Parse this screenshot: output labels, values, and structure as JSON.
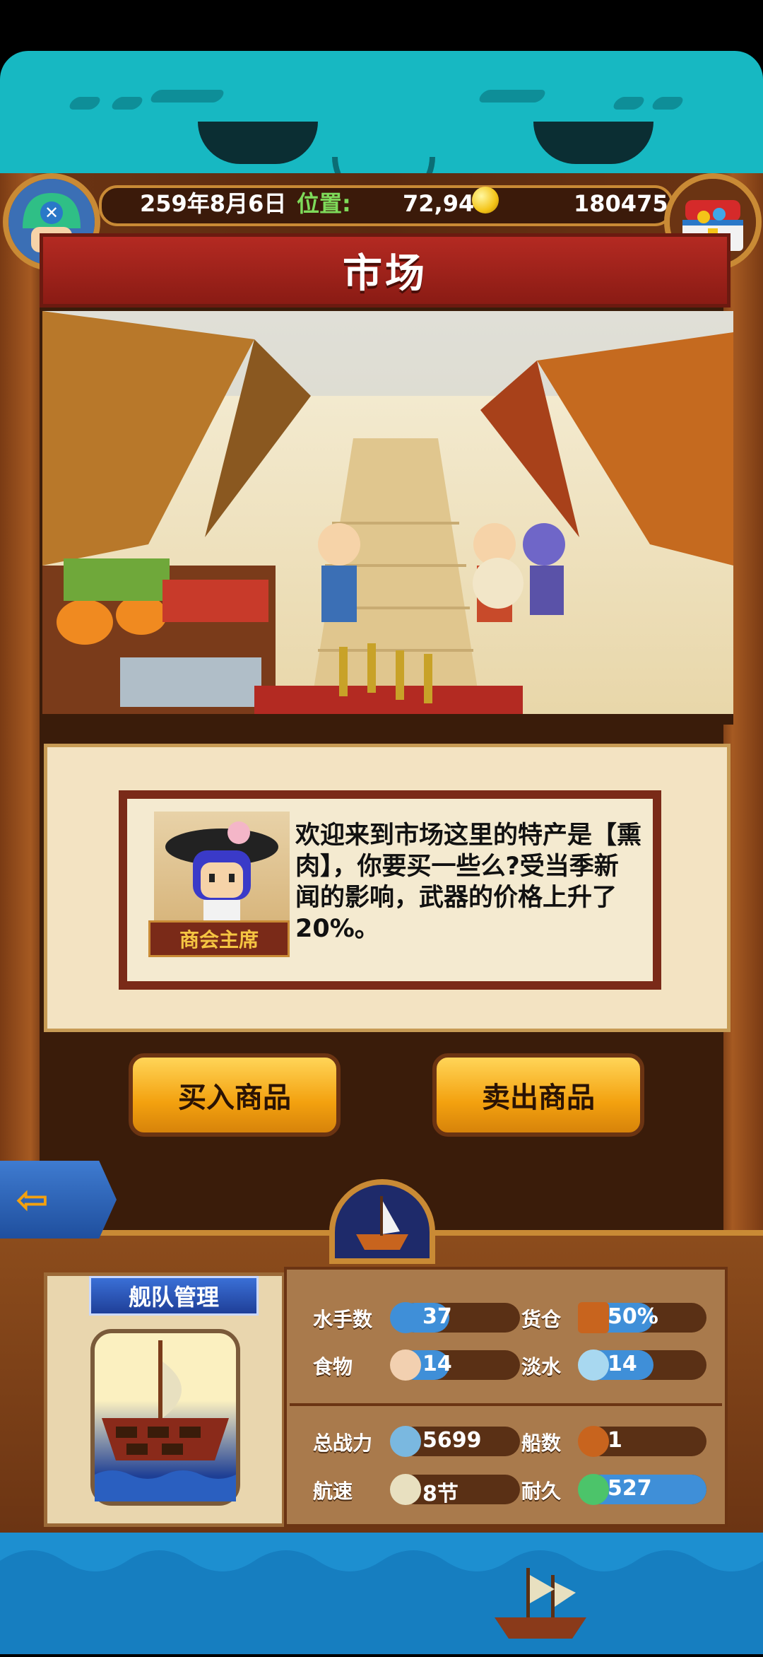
{
  "header": {
    "date": "259年8月6日",
    "location_label": "位置:",
    "coordinates": "72,94",
    "gold": "180475"
  },
  "title": "市场",
  "dialog": {
    "speaker_role": "商会主席",
    "message": "欢迎来到市场这里的特产是【熏肉】，你要买一些么?受当季新闻的影响，武器的价格上升了20%。"
  },
  "buttons": {
    "buy": "买入商品",
    "sell": "卖出商品"
  },
  "fleet": {
    "label": "舰队管理",
    "stats": {
      "sailors_label": "水手数",
      "sailors_value": "37",
      "cargo_label": "货仓",
      "cargo_value": "50%",
      "food_label": "食物",
      "food_value": "14",
      "water_label": "淡水",
      "water_value": "14",
      "power_label": "总战力",
      "power_value": "5699",
      "ships_label": "船数",
      "ships_value": "1",
      "speed_label": "航速",
      "speed_value": "8节",
      "durability_label": "耐久",
      "durability_value": "527"
    }
  },
  "colors": {
    "teal_banner": "#17b8c2",
    "wood": "#6b3413",
    "title_red": "#b42a22",
    "button_gold": "#f3a10f",
    "stat_blue": "#3f8fd8"
  }
}
